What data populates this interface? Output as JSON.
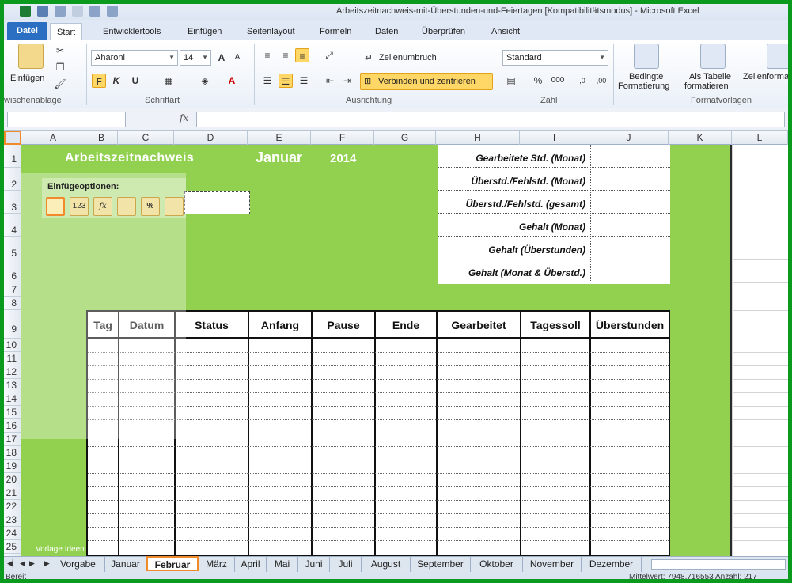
{
  "window": {
    "title": "Arbeitszeitnachweis-mit-Überstunden-und-Feiertagen [Kompatibilitätsmodus] - Microsoft Excel"
  },
  "ribbon": {
    "tabs": [
      "Datei",
      "Start",
      "Entwicklertools",
      "Einfügen",
      "Seitenlayout",
      "Formeln",
      "Daten",
      "Überprüfen",
      "Ansicht"
    ],
    "active_tab": "Start",
    "clipboard": {
      "paste_label": "Einfügen",
      "group_label": "wischenablage"
    },
    "font": {
      "name": "Aharoni",
      "size": "14",
      "group_label": "Schriftart",
      "bold": "F",
      "italic": "K",
      "underline": "U"
    },
    "alignment": {
      "wrap_text": "Zeilenumbruch",
      "merge_center": "Verbinden und zentrieren",
      "group_label": "Ausrichtung"
    },
    "number": {
      "format": "Standard",
      "percent": "%",
      "thousands": "000",
      "group_label": "Zahl"
    },
    "styles": {
      "conditional": "Bedingte",
      "conditional2": "Formatierung",
      "as_table": "Als Tabelle",
      "as_table2": "formatieren",
      "cell_styles": "Zellenforma",
      "group_label": "Formatvorlagen"
    }
  },
  "formula_bar": {
    "fx": "fx"
  },
  "columns": [
    "A",
    "B",
    "C",
    "D",
    "E",
    "F",
    "G",
    "H",
    "I",
    "J",
    "K",
    "L"
  ],
  "rows": [
    "1",
    "2",
    "3",
    "4",
    "5",
    "6",
    "7",
    "8",
    "9",
    "10",
    "11",
    "12",
    "13",
    "14",
    "15",
    "16",
    "17",
    "18",
    "19",
    "20",
    "21",
    "22",
    "23",
    "24",
    "25"
  ],
  "sheet": {
    "title": "Arbeitszeitnachweis",
    "month": "Januar",
    "year": "2014",
    "summary": [
      "Gearbeitete Std. (Monat)",
      "Überstd./Fehlstd. (Monat)",
      "Überstd./Fehlstd. (gesamt)",
      "Gehalt (Monat)",
      "Gehalt (Überstunden)",
      "Gehalt (Monat & Überstd.)"
    ],
    "table_headers": [
      "Tag",
      "Datum",
      "Status",
      "Anfang",
      "Pause",
      "Ende",
      "Gearbeitet",
      "Tagessoll",
      "Überstunden"
    ],
    "watermark": "Vorlage Ideen"
  },
  "paste_options": {
    "label": "Einfügeoptionen:",
    "buttons": [
      "paste",
      "values",
      "formulas",
      "transpose",
      "formatting",
      "link"
    ],
    "glyphs": [
      "",
      "123",
      "fx",
      "",
      "%",
      ""
    ]
  },
  "sheet_tabs": [
    "Vorgabe",
    "Januar",
    "Februar",
    "März",
    "April",
    "Mai",
    "Juni",
    "Juli",
    "August",
    "September",
    "Oktober",
    "November",
    "Dezember"
  ],
  "active_sheet": "Februar",
  "status": {
    "left": "Bereit",
    "right": "Mittelwert: 7948,716553    Anzahl: 217"
  },
  "colors": {
    "accent_green": "#92d050",
    "frame": "#0a9a1e",
    "highlight": "#f08a2a"
  }
}
